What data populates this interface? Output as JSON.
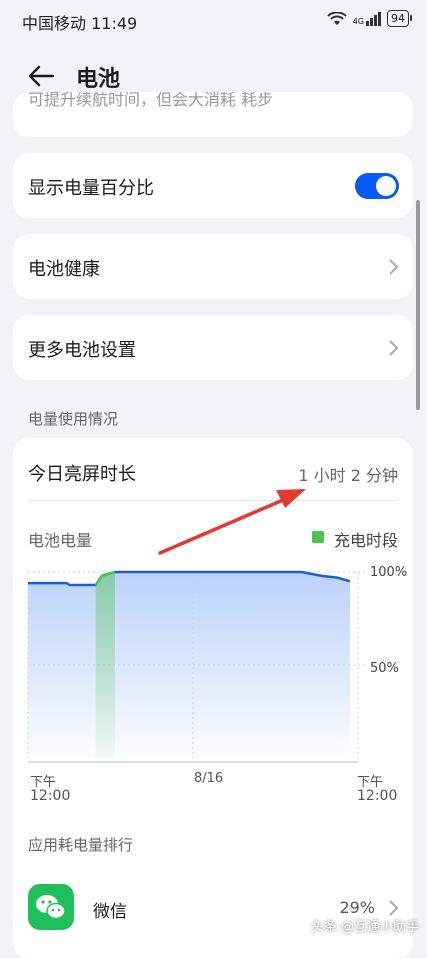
{
  "status": {
    "carrier": "中国移动",
    "time": "11:49",
    "network": "4G",
    "battery": "94"
  },
  "header": {
    "title": "电池"
  },
  "partial_card": {
    "text": "可提升续航时间，但会大消耗 耗步"
  },
  "settings": {
    "percentage_label": "显示电量百分比",
    "percentage_enabled": true,
    "health_label": "电池健康",
    "more_label": "更多电池设置"
  },
  "usage": {
    "section_title": "电量使用情况",
    "screen_time_label": "今日亮屏时长",
    "screen_time_value": "1 小时 2 分钟",
    "battery_level_label": "电池电量",
    "legend_charging": "充电时段"
  },
  "chart_data": {
    "type": "area",
    "title": "电池电量",
    "y_ticks": [
      "100%",
      "50%"
    ],
    "ylim": [
      0,
      100
    ],
    "x_ticks": [
      {
        "top": "下午",
        "bottom": "12:00"
      },
      {
        "top": "8/16",
        "bottom": ""
      },
      {
        "top": "下午",
        "bottom": "12:00"
      }
    ],
    "series": [
      {
        "name": "电池电量",
        "points": [
          [
            0,
            94
          ],
          [
            0.12,
            94
          ],
          [
            0.13,
            93
          ],
          [
            0.2,
            93
          ],
          [
            0.21,
            93
          ],
          [
            0.23,
            98
          ],
          [
            0.27,
            100
          ],
          [
            0.85,
            100
          ],
          [
            0.88,
            99
          ],
          [
            0.91,
            98
          ],
          [
            0.96,
            97
          ],
          [
            1.0,
            95
          ]
        ]
      }
    ],
    "charging_range": [
      0.21,
      0.27
    ],
    "colors": {
      "line": "#1a5fd6",
      "fill": "#bcd2fb",
      "charging": "#4cc44c"
    }
  },
  "ranking": {
    "section_title": "应用耗电量排行",
    "apps": [
      {
        "name": "微信",
        "percent": "29%",
        "icon": "wechat-icon"
      }
    ]
  },
  "watermark": "头条 @互通小助手"
}
